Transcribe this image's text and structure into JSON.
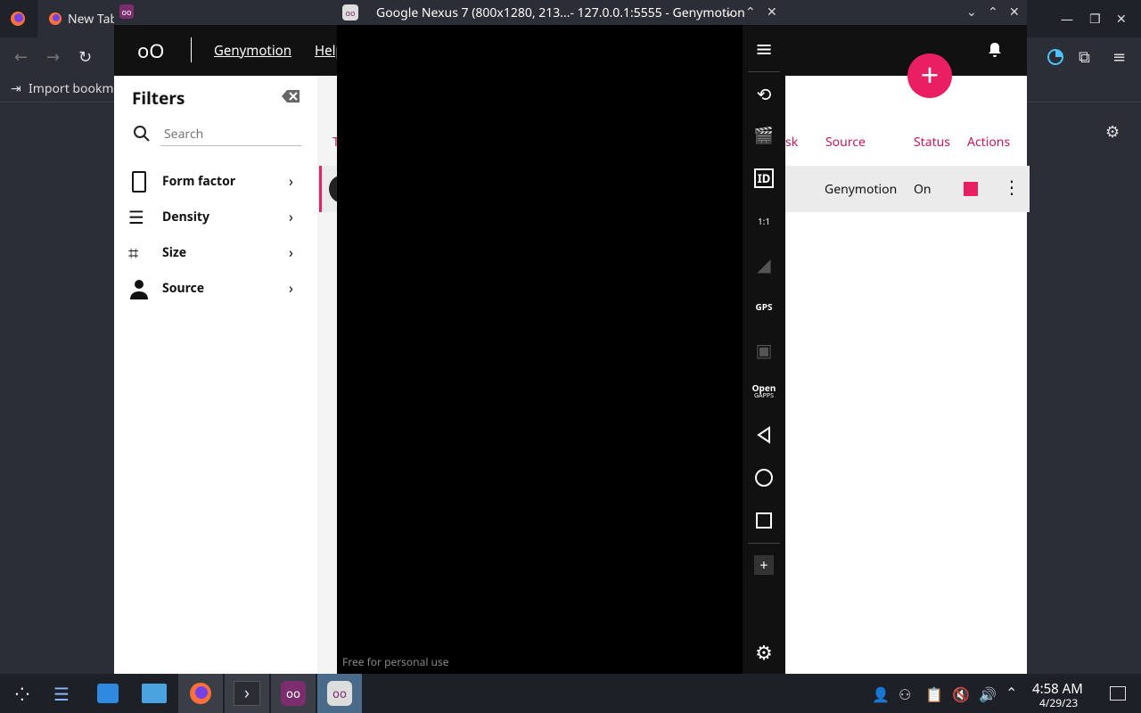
{
  "browser": {
    "tab_title": "New Tab",
    "bookmark_label": "Import bookmarks..."
  },
  "genymotion": {
    "header": {
      "brand_name": "Genymotion",
      "help_label": "Help"
    },
    "filters": {
      "title": "Filters",
      "search_placeholder": "Search",
      "items": [
        {
          "label": "Form factor"
        },
        {
          "label": "Density"
        },
        {
          "label": "Size"
        },
        {
          "label": "Source"
        }
      ]
    },
    "table": {
      "columns": [
        "Source",
        "Status",
        "Actions"
      ],
      "partial_columns": [
        "sk",
        "T"
      ],
      "row": {
        "source": "Genymotion",
        "status": "On"
      }
    }
  },
  "device_window": {
    "title": "Google Nexus 7 (800x1280, 213...- 127.0.0.1:5555 - Genymotion",
    "watermark": "Free for personal use",
    "toolbar": {
      "id_label": "ID",
      "ratio_label": "1:1",
      "gps_label": "GPS",
      "opengapps_top": "Open",
      "opengapps_bottom": "GAPPS"
    }
  },
  "taskbar": {
    "time": "4:58 AM",
    "date": "4/29/23"
  },
  "colors": {
    "accent": "#e91e63",
    "header_bg": "#111111",
    "taskbar_bg": "#1d2026"
  }
}
